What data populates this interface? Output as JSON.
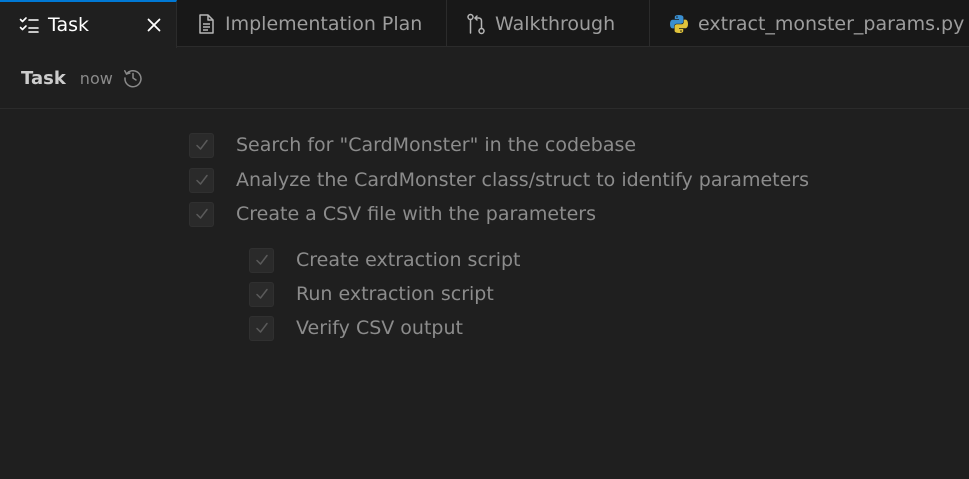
{
  "tabs": [
    {
      "label": "Task",
      "icon": "checklist-icon",
      "active": true
    },
    {
      "label": "Implementation Plan",
      "icon": "document-icon"
    },
    {
      "label": "Walkthrough",
      "icon": "git-compare-icon"
    },
    {
      "label": "extract_monster_params.py",
      "icon": "python-icon"
    }
  ],
  "header": {
    "title": "Task",
    "time": "now",
    "history_icon": "history-icon"
  },
  "tasks": [
    {
      "label": "Search for \"CardMonster\" in the codebase",
      "checked": true
    },
    {
      "label": "Analyze the CardMonster class/struct to identify parameters",
      "checked": true
    },
    {
      "label": "Create a CSV file with the parameters",
      "checked": true
    }
  ],
  "subtasks": [
    {
      "label": "Create extraction script",
      "checked": true
    },
    {
      "label": "Run extraction script",
      "checked": true
    },
    {
      "label": "Verify CSV output",
      "checked": true
    }
  ],
  "colors": {
    "accent": "#0078d4",
    "background": "#1f1f1f",
    "tabbar": "#181818",
    "python_blue": "#3a8fd1",
    "python_yellow": "#e0c33b"
  }
}
